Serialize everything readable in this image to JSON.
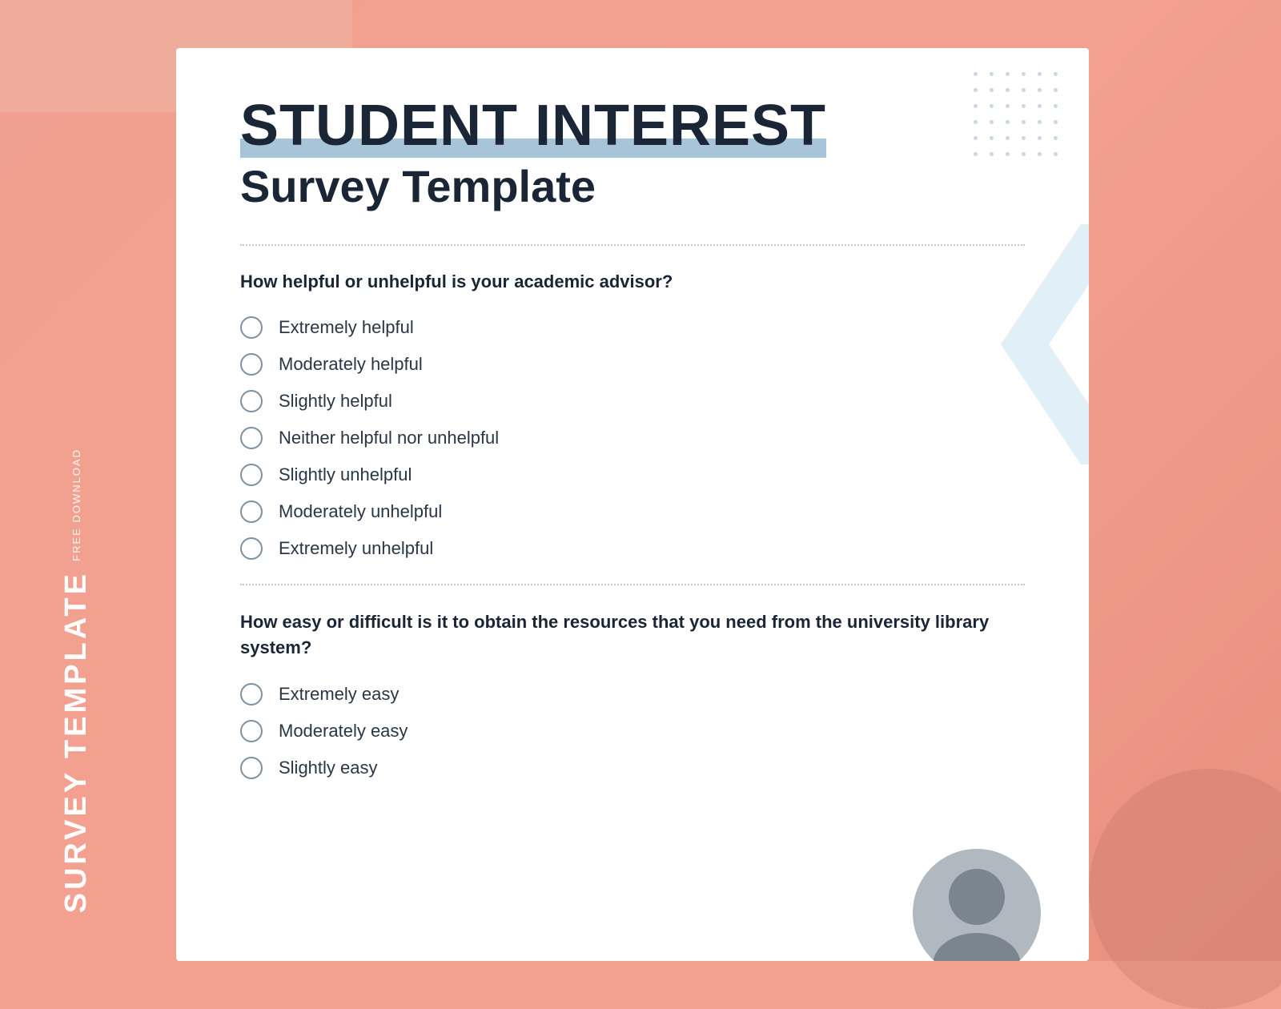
{
  "background": {
    "color": "#f4a090"
  },
  "sidebar": {
    "free_download_label": "FREE DOWNLOAD",
    "title_label": "SURVEY TEMPLATE"
  },
  "header": {
    "title_line1": "STUDENT INTEREST",
    "title_line2": "Survey Template"
  },
  "question1": {
    "label": "How helpful or unhelpful is your academic advisor?",
    "options": [
      "Extremely helpful",
      "Moderately helpful",
      "Slightly helpful",
      "Neither helpful nor unhelpful",
      "Slightly unhelpful",
      "Moderately unhelpful",
      "Extremely unhelpful"
    ]
  },
  "question2": {
    "label": "How easy or difficult is it to obtain the resources that you need from the university library system?",
    "options": [
      "Extremely easy",
      "Moderately easy",
      "Slightly easy"
    ]
  },
  "colors": {
    "accent_blue": "#a8c4d8",
    "text_dark": "#1a2535",
    "radio_border": "#8090a0"
  }
}
